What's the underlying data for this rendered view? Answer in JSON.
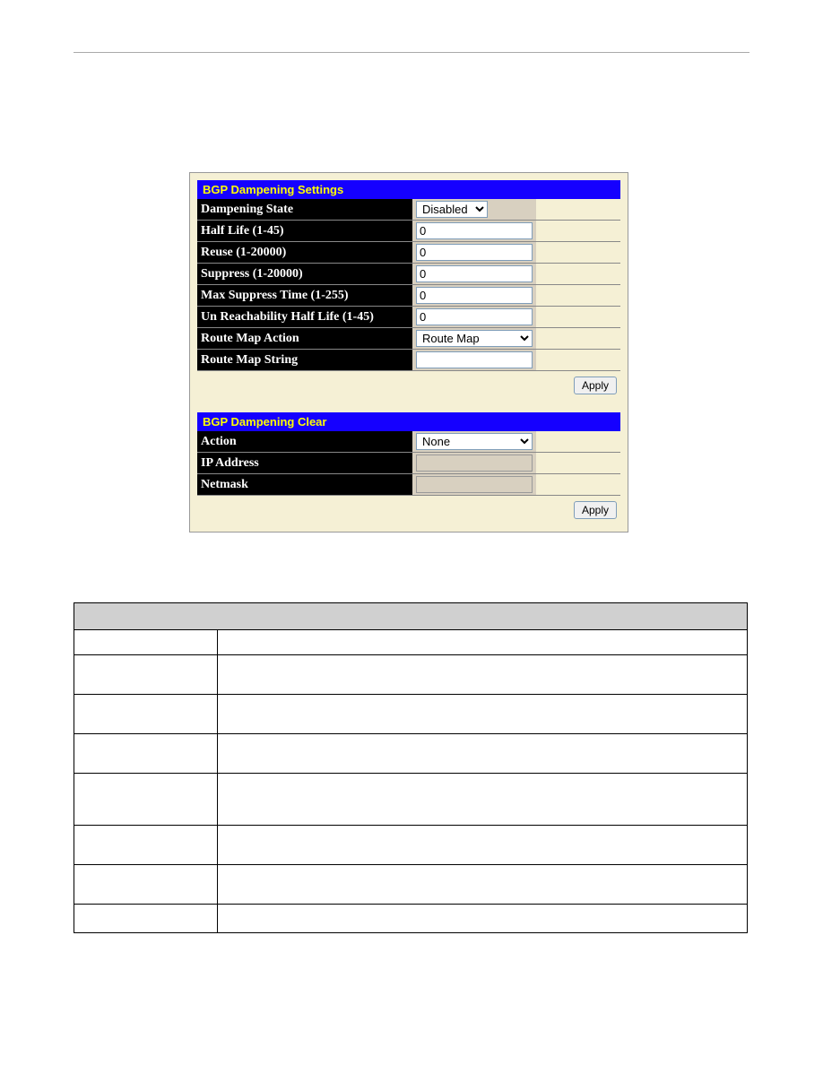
{
  "settingsPanel": {
    "header": "BGP Dampening Settings",
    "rows": {
      "dampeningState": {
        "label": "Dampening State",
        "value": "Disabled"
      },
      "halfLife": {
        "label": "Half Life (1-45)",
        "value": "0"
      },
      "reuse": {
        "label": "Reuse (1-20000)",
        "value": "0"
      },
      "suppress": {
        "label": "Suppress (1-20000)",
        "value": "0"
      },
      "maxSuppress": {
        "label": "Max Suppress Time (1-255)",
        "value": "0"
      },
      "unReach": {
        "label": "Un Reachability Half Life (1-45)",
        "value": "0"
      },
      "routeMapAction": {
        "label": "Route Map Action",
        "value": "Route Map"
      },
      "routeMapString": {
        "label": "Route Map String",
        "value": ""
      }
    },
    "applyLabel": "Apply"
  },
  "clearPanel": {
    "header": "BGP Dampening Clear",
    "rows": {
      "action": {
        "label": "Action",
        "value": "None"
      },
      "ipAddress": {
        "label": "IP Address",
        "value": ""
      },
      "netmask": {
        "label": "Netmask",
        "value": ""
      }
    },
    "applyLabel": "Apply"
  }
}
